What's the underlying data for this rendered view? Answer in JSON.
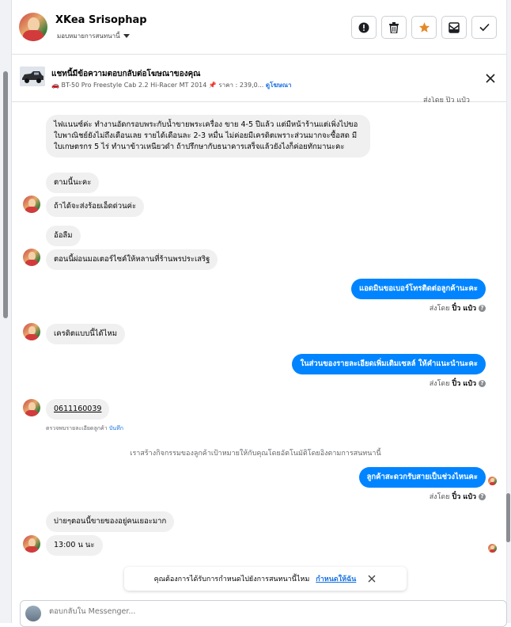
{
  "header": {
    "name": "XKea Srisophap",
    "assign_label": "มอบหมายการสนทนานี้",
    "actions": [
      "alert-icon",
      "trash-icon",
      "star-icon",
      "mark-unread-icon",
      "check-icon"
    ],
    "star_color": "#e4892b"
  },
  "ad": {
    "title": "แชทนี้มีข้อความตอบกลับต่อโฆษณาของคุณ",
    "product": "BT-50 Pro Freestyle Cab 2.2 Hi-Racer MT 2014",
    "price": "ราคา : 239,0...",
    "link": "ดูโฆษณา"
  },
  "messages": {
    "cutoff_sent": "ส่งโดย ปิ๋ว แป๋ว",
    "m1": "ไฟแนนซ์ค่ะ ทำงานอัดกรอบพระกับน้ำขายพระเครื่อง ขาย 4-5 ปีแล้ว แต่มีหน้าร้านแต่เพิ่งไปขอใบพาณิชย์ยังไม่ถึงเดือนเลย รายได้เดือนละ 2-3 หมื่น ไม่ค่อยมีเครดิตเพราะส่วนมากจะซื้อสด มีใบเกษตรกร 5 ไร่ ทำนาข้าวเหนียวดำ ถ้าปรึกษากับธนาคารเสร็จแล้วยังไงก็ค่อยทักมานะคะ",
    "m2": "ตามนี้นะคะ",
    "m3": "ถ้าได้จะส่งร้อยเอ็ดด่วนค่ะ",
    "m4": "อ้อลืม",
    "m5": "ตอนนี้ผ่อนมอเตอร์ไซค์ให้หลานที่ร้านพรประเสริฐ",
    "o1": "แอดมินขอเบอร์โทรติดต่อลูกค้านะคะ",
    "sent_prefix": "ส่งโดย",
    "sent_name": "ปิ๋ว แป๋ว",
    "m6": "เครดิตแบบนี้ได้ไหม",
    "o2": "ในส่วนของรายละเอียดเพิ่มเติมเซลล์ ให้คำแนะนำนะคะ",
    "m7": "0611160039",
    "note": "ตรวจพบรายละเอียดลูกค้า",
    "note_link": "บันทึก",
    "system": "เราสร้างกิจกรรมของลูกค้าเป้าหมายให้กับคุณโดยอัตโนมัติโดยอิงตามการสนทนานี้",
    "o3": "ลูกค้าสะดวกรับสายเป็นช่วงไหนคะ",
    "m8": "บ่ายๆตอนนี้ขายของอยู่คนเยอะมาก",
    "m9": "13:00 น นะ"
  },
  "toast": {
    "text": "คุณต้องการได้รับการกำหนดไปยังการสนทนานี้ไหม",
    "link": "กำหนดให้ฉัน"
  },
  "composer": {
    "placeholder": "ตอบกลับใน Messenger..."
  },
  "colors": {
    "outgoing": "#0084ff",
    "incoming": "#f0f0f0",
    "link": "#1b74e4"
  }
}
